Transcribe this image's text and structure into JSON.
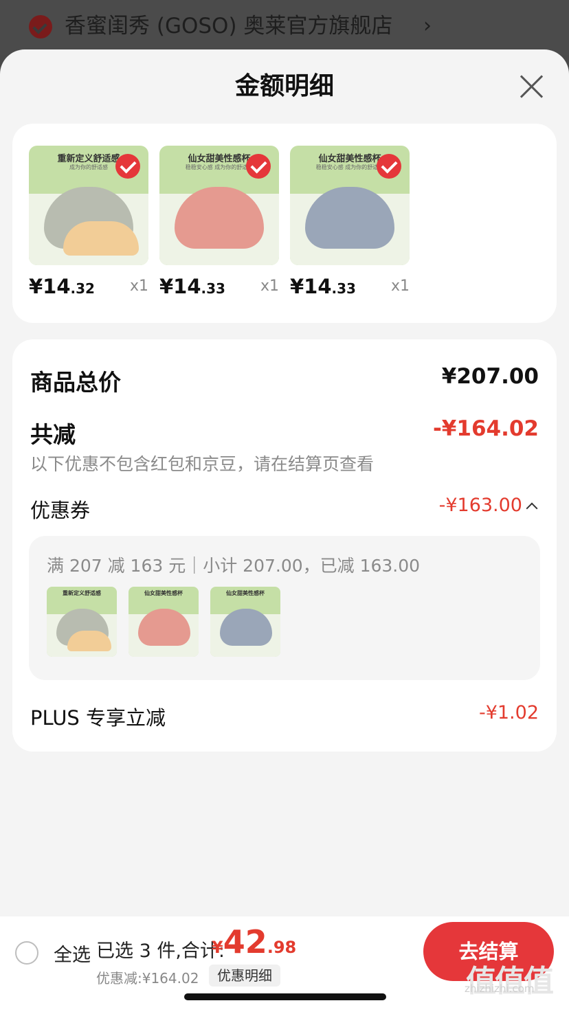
{
  "store": {
    "name": "香蜜闺秀 (GOSO) 奥莱官方旗舰店",
    "chevron": "›"
  },
  "sheet": {
    "title": "金额明细",
    "products": [
      {
        "caption": "重新定义舒适感",
        "subcaption": "成为你的舒适感",
        "price_int": "¥14",
        "price_dec": ".32",
        "qty": "x1",
        "color": "#b8bcb0"
      },
      {
        "caption": "仙女甜美性感杯",
        "subcaption": "稳稳安心感 成为你的舒适感",
        "price_int": "¥14",
        "price_dec": ".33",
        "qty": "x1",
        "color": "#e59a90"
      },
      {
        "caption": "仙女甜美性感杯",
        "subcaption": "稳稳安心感 成为你的舒适感",
        "price_int": "¥14",
        "price_dec": ".33",
        "qty": "x1",
        "color": "#9aa6b8"
      }
    ],
    "summary": {
      "total_label": "商品总价",
      "total_value": "¥207.00",
      "reduce_label": "共减",
      "reduce_value": "-¥164.02",
      "note": "以下优惠不包含红包和京豆，请在结算页查看",
      "coupon_label": "优惠券",
      "coupon_value": "-¥163.00",
      "coupon_detail": "满 207 减 163 元｜小计 207.00，已减 163.00",
      "plus_label": "PLUS 专享立减",
      "plus_value": "-¥1.02"
    }
  },
  "bottom": {
    "select_all": "全选",
    "selected_summary": "已选 3 件,合计:",
    "total_currency": "¥",
    "total_int": "42",
    "total_dec": ".98",
    "discount": "优惠减:¥164.02",
    "detail_button": "优惠明细",
    "checkout_button": "去结算"
  },
  "watermark": {
    "logo": "值值值",
    "domain": "zhizhizhi.com"
  }
}
